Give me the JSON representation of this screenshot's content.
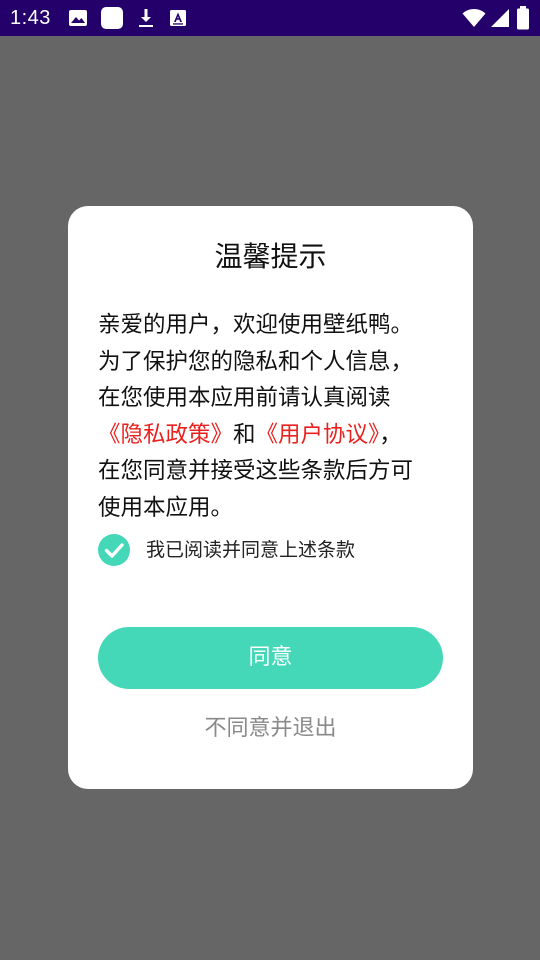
{
  "status_bar": {
    "time": "1:43",
    "left_icons": [
      "image-icon",
      "square-notification-icon",
      "download-icon",
      "font-app-icon"
    ],
    "right_icons": [
      "wifi-icon",
      "cellular-signal-icon",
      "battery-icon"
    ],
    "background_color": "#24006b"
  },
  "dialog": {
    "title": "温馨提示",
    "body": {
      "line1": "亲爱的用户，欢迎使用壁纸鸭。",
      "line2": "为了保护您的隐私和个人信息，",
      "line3": "在您使用本应用前请认真阅读",
      "privacy_policy_link": "《隐私政策》",
      "conjunction": "和",
      "user_agreement_link": "《用户协议》",
      "line4_tail": "，",
      "line5": "在您同意并接受这些条款后方可",
      "line6": "使用本应用。"
    },
    "agree_checkbox": {
      "label": "我已阅读并同意上述条款",
      "checked": true
    },
    "agree_button_label": "同意",
    "decline_label": "不同意并退出"
  },
  "colors": {
    "overlay": "#666666",
    "accent": "#44d8b8",
    "link_red": "#e8231f",
    "decline_gray": "#8a8a8a"
  }
}
